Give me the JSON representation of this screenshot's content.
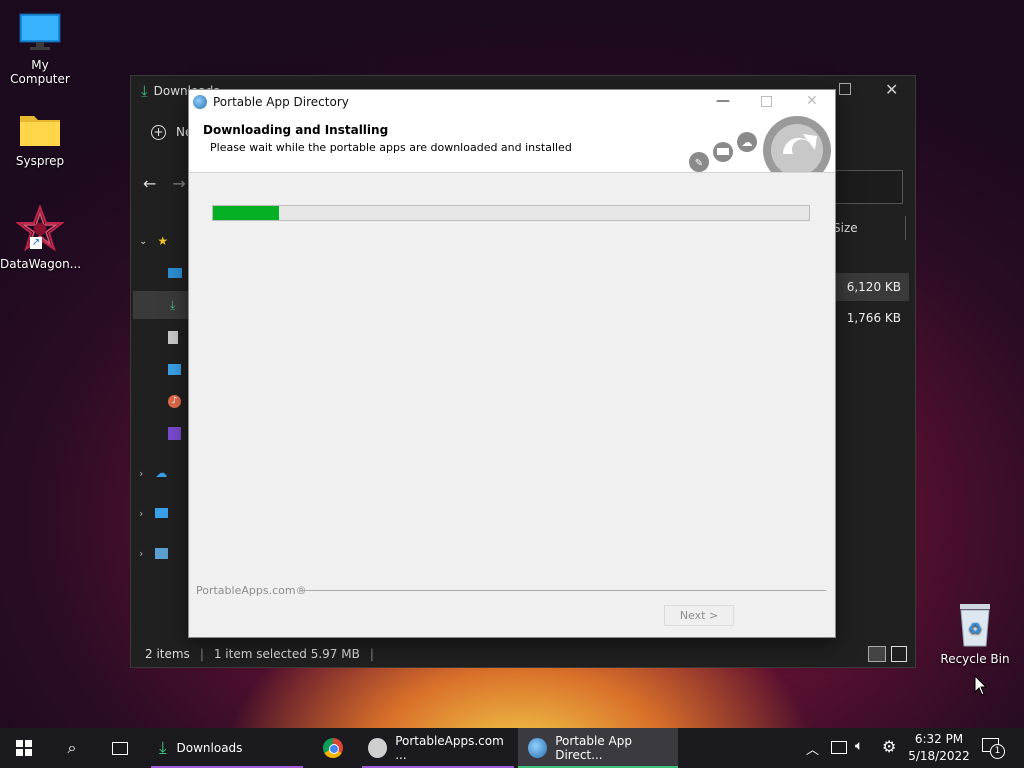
{
  "desktop": {
    "icons": [
      {
        "label": "My Computer"
      },
      {
        "label": "Sysprep"
      },
      {
        "label": "DataWagon..."
      },
      {
        "label": "Recycle Bin"
      }
    ]
  },
  "explorer": {
    "title": "Downloads",
    "new_label": "New",
    "column_size": "Size",
    "sizes": [
      "6,120 KB",
      "1,766 KB"
    ],
    "status_items": "2 items",
    "status_selected": "1 item selected  5.97 MB"
  },
  "installer": {
    "title": "Portable App Directory",
    "heading": "Downloading and Installing",
    "subheading": "Please wait while the portable apps are downloaded and installed",
    "progress": 0.11,
    "branding": "PortableApps.com®",
    "next_label": "Next >"
  },
  "taskbar": {
    "apps": [
      {
        "label": "Downloads"
      },
      {
        "label": "PortableApps.com ..."
      },
      {
        "label": "Portable App Direct..."
      }
    ],
    "time": "6:32 PM",
    "date": "5/18/2022",
    "notification_count": "1"
  },
  "colors": {
    "accent_green": "#06b025",
    "taskbar_underline": "#a25bd6"
  }
}
